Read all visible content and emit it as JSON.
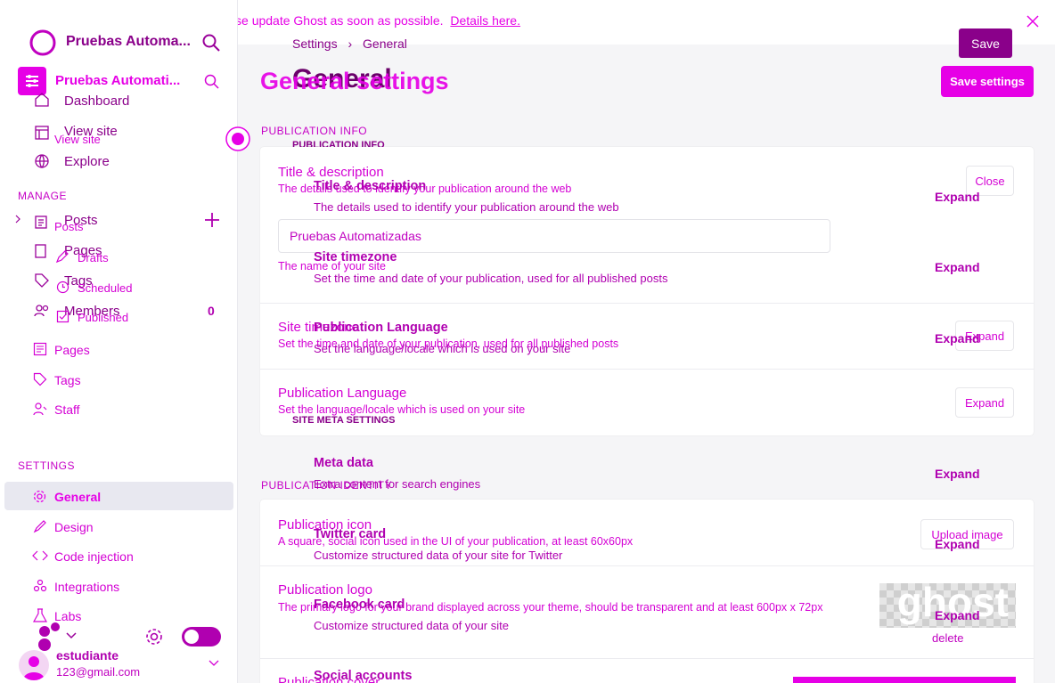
{
  "banner": {
    "text": "Critical security update available — please update Ghost as soon as possible.",
    "link": "Details here."
  },
  "sidebar": {
    "site_title_top": "Pruebas Automa...",
    "site_title": "Pruebas Automati...",
    "old_nav": [
      {
        "label": "Dashboard"
      },
      {
        "label": "View site"
      },
      {
        "label": "Explore"
      },
      {
        "label": "Posts"
      },
      {
        "label": "Pages"
      },
      {
        "label": "Tags"
      },
      {
        "label": "Members"
      }
    ],
    "members_count": "0",
    "manage_heading": "MANAGE",
    "view_site_small": "View site",
    "posts_small": "Posts",
    "drafts": "Drafts",
    "scheduled": "Scheduled",
    "published": "Published",
    "pages": "Pages",
    "tags": "Tags",
    "staff": "Staff",
    "settings_heading": "SETTINGS",
    "settings_items": [
      {
        "label": "General"
      },
      {
        "label": "Design"
      },
      {
        "label": "Code injection"
      },
      {
        "label": "Integrations"
      },
      {
        "label": "Labs"
      }
    ],
    "user_name": "estudiante",
    "user_email": "123@gmail.com"
  },
  "header": {
    "breadcrumb_root": "Settings",
    "breadcrumb_current": "General",
    "save_label": "Save",
    "save_settings_label": "Save settings",
    "title_old": "General",
    "title_new": "General settings"
  },
  "publication_info": {
    "heading": "PUBLICATION INFO",
    "title_desc": {
      "title": "Title & description",
      "desc": "The details used to identify your publication around the web",
      "button": "Close",
      "input_value": "Pruebas Automatizadas",
      "input_help": "The name of your site"
    },
    "timezone": {
      "title": "Site timezone",
      "desc": "Set the time and date of your publication, used for all published posts",
      "button": "Expand"
    },
    "language": {
      "title": "Publication Language",
      "desc": "Set the language/locale which is used on your site",
      "button": "Expand"
    }
  },
  "overlay": {
    "pub_info_heading": "PUBLICATION INFO",
    "site_meta_heading": "SITE META SETTINGS",
    "items": [
      {
        "title": "Title & description",
        "desc": "The details used to identify your publication around the web",
        "action": "Expand"
      },
      {
        "title": "Site timezone",
        "desc": "Set the time and date of your publication, used for all published posts",
        "action": "Expand"
      },
      {
        "title": "Publication Language",
        "desc": "Set the language/locale which is used on your site",
        "action": "Expand"
      },
      {
        "title": "Meta data",
        "desc": "Extra content for search engines",
        "action": "Expand"
      },
      {
        "title": "Twitter card",
        "desc": "Customize structured data of your site for Twitter",
        "action": "Expand"
      },
      {
        "title": "Facebook card",
        "desc": "Customize structured data of your site",
        "action": "Expand"
      },
      {
        "title": "Social accounts",
        "desc": "",
        "action": ""
      }
    ]
  },
  "publication_identity": {
    "heading": "PUBLICATION IDENTITY",
    "icon": {
      "title": "Publication icon",
      "desc": "A square, social icon used in the UI of your publication, at least 60x60px",
      "button": "Upload image"
    },
    "logo": {
      "title": "Publication logo",
      "desc": "The primary logo for your brand displayed across your theme, should be transparent and at least 600px x 72px",
      "logo_text": "ghost",
      "delete": "delete"
    },
    "cover": {
      "title": "Publication cover"
    }
  },
  "colors": {
    "accent": "#e600e6",
    "accent_dark": "#7a007a",
    "sidebar_active": "#e8e8f0",
    "main_bg": "#f5f5f7"
  }
}
